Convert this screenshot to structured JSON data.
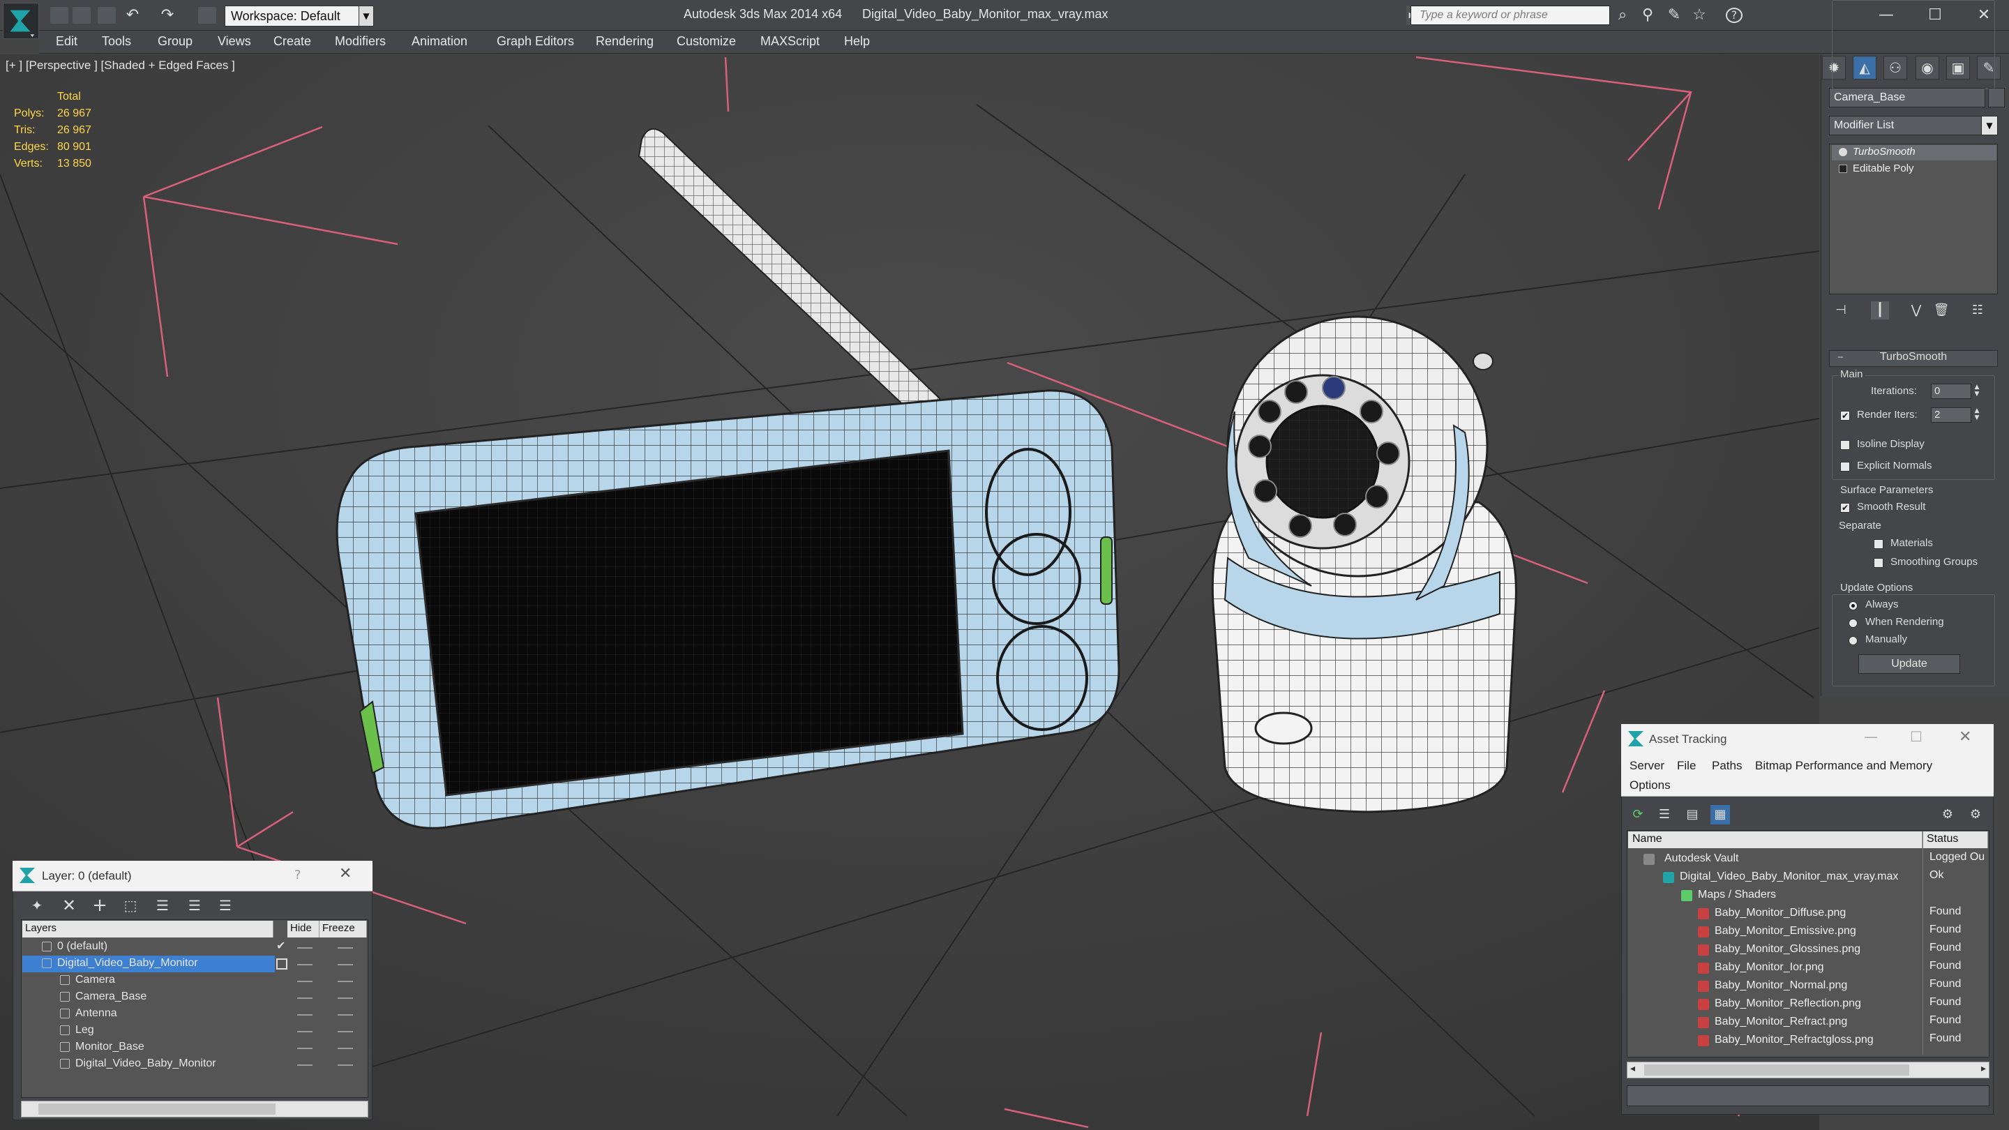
{
  "app": {
    "title": "Autodesk 3ds Max  2014 x64",
    "file": "Digital_Video_Baby_Monitor_max_vray.max",
    "workspace": "Workspace: Default",
    "search_placeholder": "Type a keyword or phrase"
  },
  "menu": [
    "Edit",
    "Tools",
    "Group",
    "Views",
    "Create",
    "Modifiers",
    "Animation",
    "Graph Editors",
    "Rendering",
    "Customize",
    "MAXScript",
    "Help"
  ],
  "viewport": {
    "label": "[+ ] [Perspective ] [Shaded + Edged Faces ]",
    "stats": {
      "header": "Total",
      "rows": [
        {
          "label": "Polys:",
          "value": "26 967"
        },
        {
          "label": "Tris:",
          "value": "26 967"
        },
        {
          "label": "Edges:",
          "value": "80 901"
        },
        {
          "label": "Verts:",
          "value": "13 850"
        }
      ]
    }
  },
  "command_panel": {
    "object_name": "Camera_Base",
    "modifier_list": "Modifier List",
    "stack": [
      "TurboSmooth",
      "Editable Poly"
    ],
    "rollout_title": "TurboSmooth",
    "main_group": "Main",
    "iterations_label": "Iterations:",
    "iterations_value": "0",
    "render_iters_label": "Render Iters:",
    "render_iters_value": "2",
    "isoline_display": "Isoline Display",
    "explicit_normals": "Explicit Normals",
    "surface_params": "Surface Parameters",
    "smooth_result": "Smooth Result",
    "separate": "Separate",
    "materials": "Materials",
    "smoothing_groups": "Smoothing Groups",
    "update_options": "Update Options",
    "always": "Always",
    "when_rendering": "When Rendering",
    "manually": "Manually",
    "update_button": "Update"
  },
  "layer_window": {
    "title": "Layer: 0 (default)",
    "help": "?",
    "columns": [
      "Layers",
      "Hide",
      "Freeze"
    ],
    "rows": [
      {
        "name": "0 (default)",
        "indent": 0
      },
      {
        "name": "Digital_Video_Baby_Monitor",
        "indent": 0,
        "selected": true
      },
      {
        "name": "Camera",
        "indent": 1
      },
      {
        "name": "Camera_Base",
        "indent": 1
      },
      {
        "name": "Antenna",
        "indent": 1
      },
      {
        "name": "Leg",
        "indent": 1
      },
      {
        "name": "Monitor_Base",
        "indent": 1
      },
      {
        "name": "Digital_Video_Baby_Monitor",
        "indent": 1
      }
    ]
  },
  "asset_tracking": {
    "title": "Asset Tracking",
    "menu": [
      "Server",
      "File",
      "Paths",
      "Bitmap Performance and Memory",
      "Options"
    ],
    "columns": [
      "Name",
      "Status"
    ],
    "rows": [
      {
        "name": "Autodesk Vault",
        "status": "Logged Ou",
        "indent": 1,
        "icon": "vault"
      },
      {
        "name": "Digital_Video_Baby_Monitor_max_vray.max",
        "status": "Ok",
        "indent": 2,
        "icon": "max"
      },
      {
        "name": "Maps / Shaders",
        "status": "",
        "indent": 3,
        "icon": "maps"
      },
      {
        "name": "Baby_Monitor_Diffuse.png",
        "status": "Found",
        "indent": 4,
        "icon": "png"
      },
      {
        "name": "Baby_Monitor_Emissive.png",
        "status": "Found",
        "indent": 4,
        "icon": "png"
      },
      {
        "name": "Baby_Monitor_Glossines.png",
        "status": "Found",
        "indent": 4,
        "icon": "png"
      },
      {
        "name": "Baby_Monitor_Ior.png",
        "status": "Found",
        "indent": 4,
        "icon": "png"
      },
      {
        "name": "Baby_Monitor_Normal.png",
        "status": "Found",
        "indent": 4,
        "icon": "png"
      },
      {
        "name": "Baby_Monitor_Reflection.png",
        "status": "Found",
        "indent": 4,
        "icon": "png"
      },
      {
        "name": "Baby_Monitor_Refract.png",
        "status": "Found",
        "indent": 4,
        "icon": "png"
      },
      {
        "name": "Baby_Monitor_Refractgloss.png",
        "status": "Found",
        "indent": 4,
        "icon": "png"
      }
    ]
  }
}
